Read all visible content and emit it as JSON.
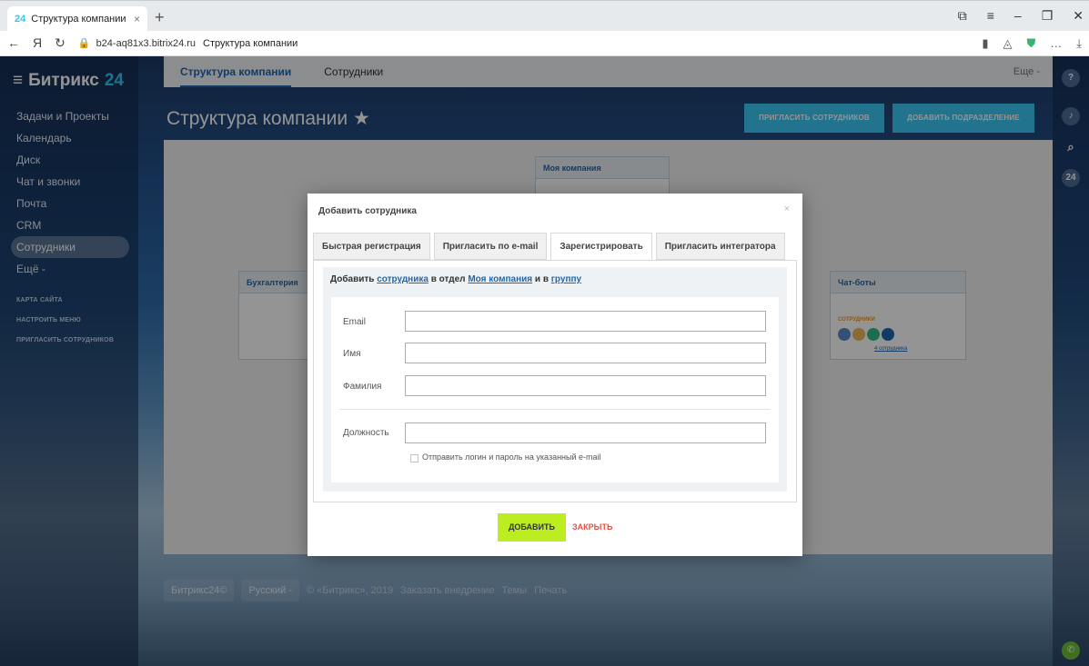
{
  "browser": {
    "tab_title": "Структура компании",
    "tab_favicon": "24",
    "tab_close": "×",
    "new_tab": "+",
    "url": "b24-aq81x3.bitrix24.ru",
    "page_title": "Структура компании",
    "yandex_letter": "Я"
  },
  "app": {
    "logo_text": "Битрикс",
    "logo_num": "24",
    "menu": [
      {
        "label": "Задачи и Проекты"
      },
      {
        "label": "Календарь"
      },
      {
        "label": "Диск"
      },
      {
        "label": "Чат и звонки"
      },
      {
        "label": "Почта"
      },
      {
        "label": "CRM"
      },
      {
        "label": "Сотрудники"
      },
      {
        "label": "Ещё -"
      }
    ],
    "small_menu": [
      {
        "label": "КАРТА САЙТА"
      },
      {
        "label": "НАСТРОИТЬ МЕНЮ"
      },
      {
        "label": "ПРИГЛАСИТЬ СОТРУДНИКОВ"
      }
    ],
    "right_badge": "24"
  },
  "top_menu": {
    "tabs": [
      {
        "label": "Структура компании"
      },
      {
        "label": "Сотрудники"
      }
    ],
    "more": "Еще -"
  },
  "page": {
    "title": "Структура компании ★",
    "invite_button": "ПРИГЛАСИТЬ СОТРУДНИКОВ",
    "add_dept_button": "ДОБАВИТЬ ПОДРАЗДЕЛЕНИЕ"
  },
  "structure": {
    "root": "Моя компания",
    "left_dept": "Бухгалтерия",
    "right_dept": "Чат-боты",
    "employees_label": "СОТРУДНИКИ",
    "employees_count": "4 сотрудника"
  },
  "footer": {
    "brand": "Битрикс24©",
    "lang": "Русский -",
    "copyright": "© «Битрикс», 2019",
    "order": "Заказать внедрение",
    "themes": "Темы",
    "print": "Печать"
  },
  "modal": {
    "title": "Добавить сотрудника",
    "close": "×",
    "tabs": [
      {
        "label": "Быстрая регистрация"
      },
      {
        "label": "Пригласить по e-mail"
      },
      {
        "label": "Зарегистрировать"
      },
      {
        "label": "Пригласить интегратора"
      }
    ],
    "hint_prefix": "Добавить ",
    "hint_employee": "сотрудника",
    "hint_middle": " в отдел ",
    "hint_dept": "Моя компания",
    "hint_and": " и в ",
    "hint_group": "группу",
    "fields": {
      "email_label": "Email",
      "email_value": "",
      "name_label": "Имя",
      "name_value": "",
      "surname_label": "Фамилия",
      "surname_value": "",
      "position_label": "Должность",
      "position_value": ""
    },
    "checkbox_label": "Отправить логин и пароль на указанный e-mail",
    "add_button": "ДОБАВИТЬ",
    "close_button": "ЗАКРЫТЬ"
  }
}
